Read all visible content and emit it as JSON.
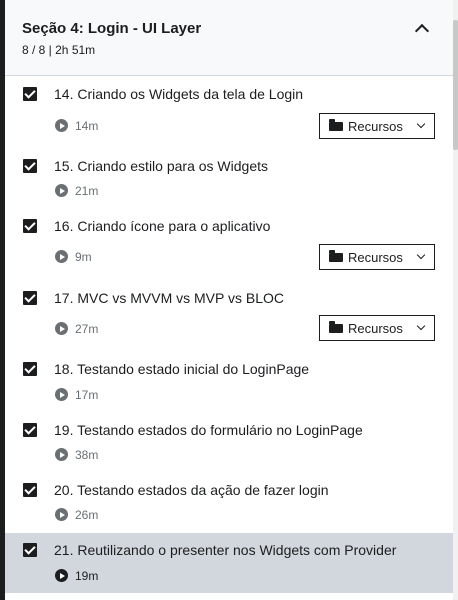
{
  "section": {
    "title": "Seção 4: Login - UI Layer",
    "meta": "8 / 8 | 2h 51m"
  },
  "resources_label": "Recursos",
  "lectures": [
    {
      "title": "14. Criando os Widgets da tela de Login",
      "duration": "14m",
      "completed": true,
      "has_resources": true
    },
    {
      "title": "15. Criando estilo para os Widgets",
      "duration": "21m",
      "completed": true,
      "has_resources": false
    },
    {
      "title": "16. Criando ícone para o aplicativo",
      "duration": "9m",
      "completed": true,
      "has_resources": true
    },
    {
      "title": "17. MVC vs MVVM vs MVP vs BLOC",
      "duration": "27m",
      "completed": true,
      "has_resources": true
    },
    {
      "title": "18. Testando estado inicial do LoginPage",
      "duration": "17m",
      "completed": true,
      "has_resources": false
    },
    {
      "title": "19. Testando estados do formulário no LoginPage",
      "duration": "38m",
      "completed": true,
      "has_resources": false
    },
    {
      "title": "20. Testando estados da ação de fazer login",
      "duration": "26m",
      "completed": true,
      "has_resources": false
    },
    {
      "title": "21. Reutilizando o presenter nos Widgets com Provider",
      "duration": "19m",
      "completed": true,
      "has_resources": false,
      "active": true
    }
  ]
}
